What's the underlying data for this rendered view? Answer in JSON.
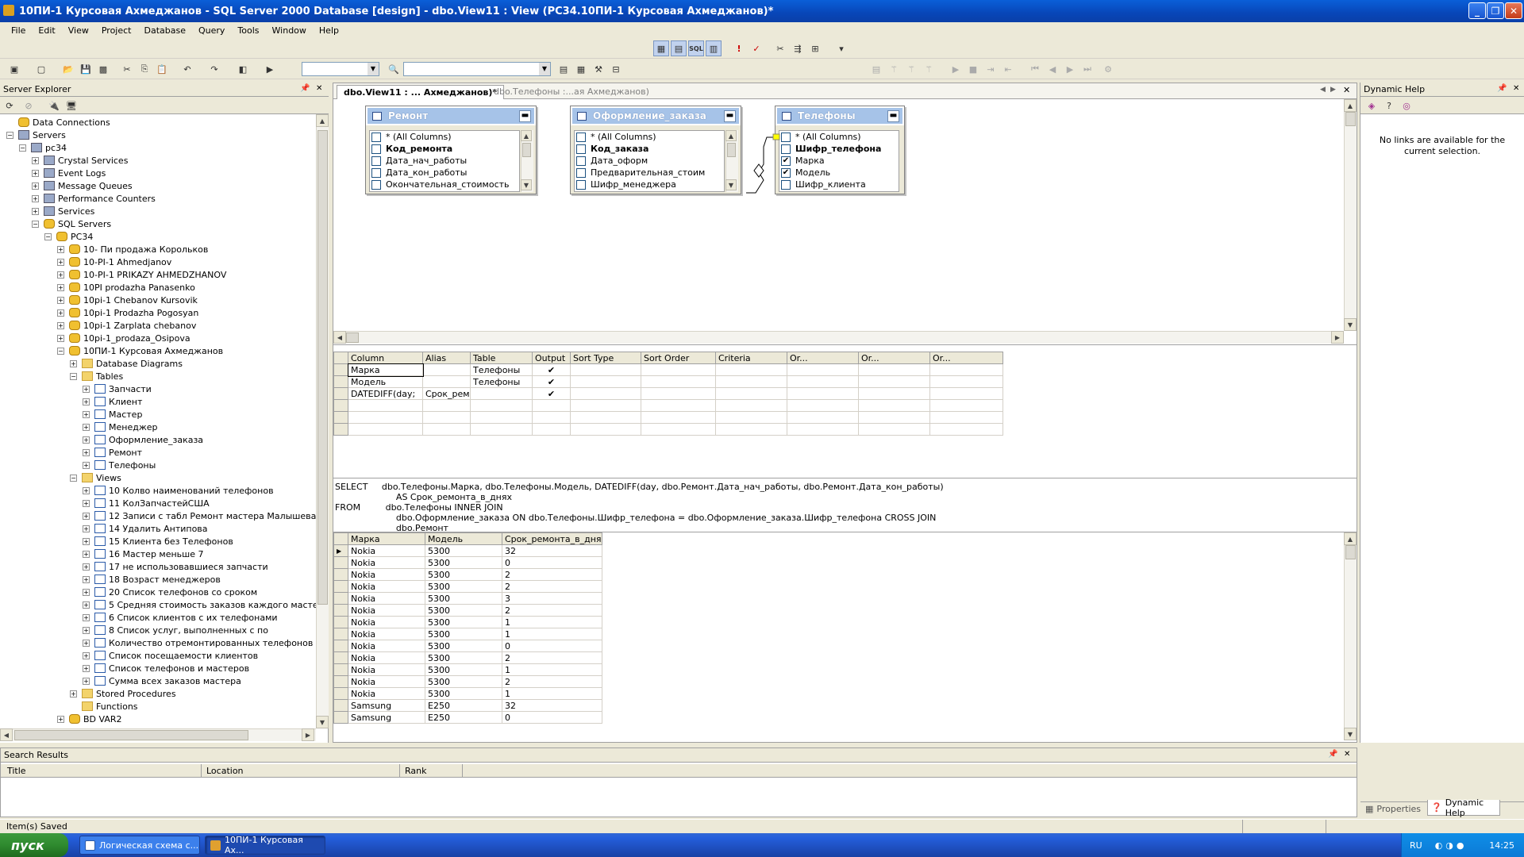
{
  "window": {
    "title": "10ПИ-1 Курсовая Ахмеджанов - SQL Server 2000 Database [design] - dbo.View11 : View (PC34.10ПИ-1 Курсовая Ахмеджанов)*"
  },
  "menu": [
    "File",
    "Edit",
    "View",
    "Project",
    "Database",
    "Query",
    "Tools",
    "Window",
    "Help"
  ],
  "server_explorer": {
    "title": "Server Explorer",
    "tree": [
      {
        "label": "Data Connections",
        "level": 0,
        "exp": "",
        "icon": "db"
      },
      {
        "label": "Servers",
        "level": 0,
        "exp": "−",
        "icon": "srv"
      },
      {
        "label": "pc34",
        "level": 1,
        "exp": "−",
        "icon": "srv"
      },
      {
        "label": "Crystal Services",
        "level": 2,
        "exp": "+",
        "icon": "srv"
      },
      {
        "label": "Event Logs",
        "level": 2,
        "exp": "+",
        "icon": "srv"
      },
      {
        "label": "Message Queues",
        "level": 2,
        "exp": "+",
        "icon": "srv"
      },
      {
        "label": "Performance Counters",
        "level": 2,
        "exp": "+",
        "icon": "srv"
      },
      {
        "label": "Services",
        "level": 2,
        "exp": "+",
        "icon": "srv"
      },
      {
        "label": "SQL Servers",
        "level": 2,
        "exp": "−",
        "icon": "db"
      },
      {
        "label": "PC34",
        "level": 3,
        "exp": "−",
        "icon": "db"
      },
      {
        "label": "10- Пи продажа Корольков",
        "level": 4,
        "exp": "+",
        "icon": "db"
      },
      {
        "label": "10-PI-1 Ahmedjanov",
        "level": 4,
        "exp": "+",
        "icon": "db"
      },
      {
        "label": "10-PI-1 PRIKAZY AHMEDZHANOV",
        "level": 4,
        "exp": "+",
        "icon": "db"
      },
      {
        "label": "10PI prodazha Panasenko",
        "level": 4,
        "exp": "+",
        "icon": "db"
      },
      {
        "label": "10pi-1 Chebanov Kursovik",
        "level": 4,
        "exp": "+",
        "icon": "db"
      },
      {
        "label": "10pi-1 Prodazha Pogosyan",
        "level": 4,
        "exp": "+",
        "icon": "db"
      },
      {
        "label": "10pi-1 Zarplata chebanov",
        "level": 4,
        "exp": "+",
        "icon": "db"
      },
      {
        "label": "10pi-1_prodaza_Osipova",
        "level": 4,
        "exp": "+",
        "icon": "db"
      },
      {
        "label": "10ПИ-1 Курсовая Ахмеджанов",
        "level": 4,
        "exp": "−",
        "icon": "db"
      },
      {
        "label": "Database Diagrams",
        "level": 5,
        "exp": "+",
        "icon": "fold"
      },
      {
        "label": "Tables",
        "level": 5,
        "exp": "−",
        "icon": "fold"
      },
      {
        "label": "Запчасти",
        "level": 6,
        "exp": "+",
        "icon": "tbl"
      },
      {
        "label": "Клиент",
        "level": 6,
        "exp": "+",
        "icon": "tbl"
      },
      {
        "label": "Мастер",
        "level": 6,
        "exp": "+",
        "icon": "tbl"
      },
      {
        "label": "Менеджер",
        "level": 6,
        "exp": "+",
        "icon": "tbl"
      },
      {
        "label": "Оформление_заказа",
        "level": 6,
        "exp": "+",
        "icon": "tbl"
      },
      {
        "label": "Ремонт",
        "level": 6,
        "exp": "+",
        "icon": "tbl"
      },
      {
        "label": "Телефоны",
        "level": 6,
        "exp": "+",
        "icon": "tbl"
      },
      {
        "label": "Views",
        "level": 5,
        "exp": "−",
        "icon": "fold"
      },
      {
        "label": "10 Колво наименований телефонов",
        "level": 6,
        "exp": "+",
        "icon": "tbl"
      },
      {
        "label": "11 КолЗапчастейСША",
        "level": 6,
        "exp": "+",
        "icon": "tbl"
      },
      {
        "label": "12 Записи с табл Ремонт мастера Малышева",
        "level": 6,
        "exp": "+",
        "icon": "tbl"
      },
      {
        "label": "14 Удалить Антипова",
        "level": 6,
        "exp": "+",
        "icon": "tbl"
      },
      {
        "label": "15 Клиента без Телефонов",
        "level": 6,
        "exp": "+",
        "icon": "tbl"
      },
      {
        "label": "16 Мастер меньше 7",
        "level": 6,
        "exp": "+",
        "icon": "tbl"
      },
      {
        "label": "17 не использовавшиеся запчасти",
        "level": 6,
        "exp": "+",
        "icon": "tbl"
      },
      {
        "label": "18 Возраст менеджеров",
        "level": 6,
        "exp": "+",
        "icon": "tbl"
      },
      {
        "label": "20 Список телефонов со сроком",
        "level": 6,
        "exp": "+",
        "icon": "tbl"
      },
      {
        "label": "5 Средняя стоимость заказов каждого мастер",
        "level": 6,
        "exp": "+",
        "icon": "tbl"
      },
      {
        "label": "6 Список клиентов с их телефонами",
        "level": 6,
        "exp": "+",
        "icon": "tbl"
      },
      {
        "label": "8 Список услуг, выполненных  с по",
        "level": 6,
        "exp": "+",
        "icon": "tbl"
      },
      {
        "label": "Количество отремонтированных телефонов к",
        "level": 6,
        "exp": "+",
        "icon": "tbl"
      },
      {
        "label": "Список посещаемости клиентов",
        "level": 6,
        "exp": "+",
        "icon": "tbl"
      },
      {
        "label": "Список телефонов и мастеров",
        "level": 6,
        "exp": "+",
        "icon": "tbl"
      },
      {
        "label": "Сумма всех заказов мастера",
        "level": 6,
        "exp": "+",
        "icon": "tbl"
      },
      {
        "label": "Stored Procedures",
        "level": 5,
        "exp": "+",
        "icon": "fold"
      },
      {
        "label": "Functions",
        "level": 5,
        "exp": "",
        "icon": "fold"
      },
      {
        "label": "BD VAR2",
        "level": 4,
        "exp": "+",
        "icon": "db"
      }
    ]
  },
  "doc_tabs": [
    {
      "label": "dbo.View11 : ... Ахмеджанов)*",
      "active": true
    },
    {
      "label": "dbo.Телефоны :...ая Ахмеджанов)",
      "active": false
    }
  ],
  "diagram_tables": [
    {
      "title": "Ремонт",
      "rows": [
        {
          "label": "* (All Columns)",
          "checked": false,
          "bold": false
        },
        {
          "label": "Код_ремонта",
          "checked": false,
          "bold": true
        },
        {
          "label": "Дата_нач_работы",
          "checked": false,
          "bold": false
        },
        {
          "label": "Дата_кон_работы",
          "checked": false,
          "bold": false
        },
        {
          "label": "Окончательная_стоимость",
          "checked": false,
          "bold": false
        }
      ]
    },
    {
      "title": "Оформление_заказа",
      "rows": [
        {
          "label": "* (All Columns)",
          "checked": false,
          "bold": false
        },
        {
          "label": "Код_заказа",
          "checked": false,
          "bold": true
        },
        {
          "label": "Дата_оформ",
          "checked": false,
          "bold": false
        },
        {
          "label": "Предварительная_стоим",
          "checked": false,
          "bold": false
        },
        {
          "label": "Шифр_менеджера",
          "checked": false,
          "bold": false
        }
      ]
    },
    {
      "title": "Телефоны",
      "rows": [
        {
          "label": "* (All Columns)",
          "checked": false,
          "bold": false
        },
        {
          "label": "Шифр_телефона",
          "checked": false,
          "bold": true
        },
        {
          "label": "Марка",
          "checked": true,
          "bold": false
        },
        {
          "label": "Модель",
          "checked": true,
          "bold": false
        },
        {
          "label": "Шифр_клиента",
          "checked": false,
          "bold": false
        }
      ]
    }
  ],
  "criteria_grid": {
    "headers": [
      "Column",
      "Alias",
      "Table",
      "Output",
      "Sort Type",
      "Sort Order",
      "Criteria",
      "Or...",
      "Or...",
      "Or..."
    ],
    "rows": [
      [
        "Марка",
        "",
        "Телефоны",
        "✔",
        "",
        "",
        "",
        "",
        "",
        ""
      ],
      [
        "Модель",
        "",
        "Телефоны",
        "✔",
        "",
        "",
        "",
        "",
        "",
        ""
      ],
      [
        "DATEDIFF(day;",
        "Срок_ремо",
        "",
        "✔",
        "",
        "",
        "",
        "",
        "",
        ""
      ],
      [
        "",
        "",
        "",
        "",
        "",
        "",
        "",
        "",
        "",
        ""
      ],
      [
        "",
        "",
        "",
        "",
        "",
        "",
        "",
        "",
        "",
        ""
      ],
      [
        "",
        "",
        "",
        "",
        "",
        "",
        "",
        "",
        "",
        ""
      ]
    ]
  },
  "sql": "SELECT     dbo.Телефоны.Марка, dbo.Телефоны.Модель, DATEDIFF(day, dbo.Ремонт.Дата_нач_работы, dbo.Ремонт.Дата_кон_работы)\n                      AS Срок_ремонта_в_днях\nFROM         dbo.Телефоны INNER JOIN\n                      dbo.Оформление_заказа ON dbo.Телефоны.Шифр_телефона = dbo.Оформление_заказа.Шифр_телефона CROSS JOIN\n                      dbo.Ремонт",
  "results": {
    "headers": [
      "Марка",
      "Модель",
      "Срок_ремонта_в_днях"
    ],
    "rows": [
      [
        "Nokia",
        "5300",
        "32"
      ],
      [
        "Nokia",
        "5300",
        "0"
      ],
      [
        "Nokia",
        "5300",
        "2"
      ],
      [
        "Nokia",
        "5300",
        "2"
      ],
      [
        "Nokia",
        "5300",
        "3"
      ],
      [
        "Nokia",
        "5300",
        "2"
      ],
      [
        "Nokia",
        "5300",
        "1"
      ],
      [
        "Nokia",
        "5300",
        "1"
      ],
      [
        "Nokia",
        "5300",
        "0"
      ],
      [
        "Nokia",
        "5300",
        "2"
      ],
      [
        "Nokia",
        "5300",
        "1"
      ],
      [
        "Nokia",
        "5300",
        "2"
      ],
      [
        "Nokia",
        "5300",
        "1"
      ],
      [
        "Samsung",
        "E250",
        "32"
      ],
      [
        "Samsung",
        "E250",
        "0"
      ]
    ]
  },
  "dynamic_help": {
    "title": "Dynamic Help",
    "message": "No links are available for the current selection.",
    "tabs": [
      "Properties",
      "Dynamic Help"
    ]
  },
  "search_results": {
    "title": "Search Results",
    "headers": [
      "Title",
      "Location",
      "Rank"
    ]
  },
  "status": "Item(s) Saved",
  "taskbar": {
    "start": "пуск",
    "tasks": [
      "Логическая схема с...",
      "10ПИ-1 Курсовая Ах..."
    ],
    "lang": "RU",
    "clock": "14:25"
  },
  "colors": {
    "titlebar": "#0a5fd8",
    "table_header": "#a6c3e8",
    "taskbar": "#245edb",
    "start": "#2f8a2f"
  }
}
